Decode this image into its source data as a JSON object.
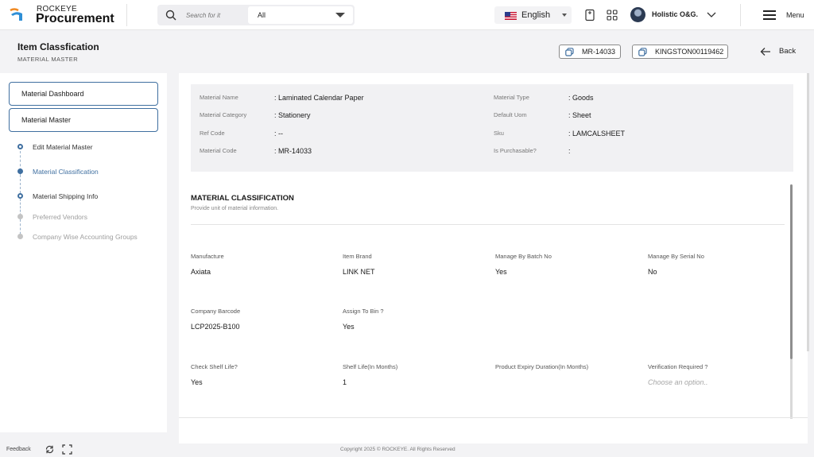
{
  "header": {
    "brand_top": "ROCKEYE",
    "brand_main": "Procurement",
    "search_placeholder": "Search for it",
    "search_scope": "All",
    "language": "English",
    "user_name": "Holistic O&G.",
    "menu_label": "Menu"
  },
  "page": {
    "title": "Item Classfication",
    "subtitle": "MATERIAL MASTER",
    "chips": [
      "MR-14033",
      "KINGSTON00119462"
    ],
    "back_label": "Back"
  },
  "sidebar": {
    "buttons": [
      "Material Dashboard",
      "Material Master"
    ],
    "steps": [
      {
        "label": "Edit Material Master",
        "state": "active"
      },
      {
        "label": "Material Classification",
        "state": "current"
      },
      {
        "label": "Material Shipping Info",
        "state": "active"
      },
      {
        "label": "Preferred Vendors",
        "state": "inactive"
      },
      {
        "label": "Company Wise Accounting Groups",
        "state": "inactive"
      }
    ]
  },
  "info": {
    "left": [
      {
        "label": "Material Name",
        "value": ": Laminated Calendar Paper"
      },
      {
        "label": "Material Category",
        "value": ": Stationery"
      },
      {
        "label": "Ref Code",
        "value": ": --"
      },
      {
        "label": "Material Code",
        "value": ": MR-14033"
      }
    ],
    "right": [
      {
        "label": "Material Type",
        "value": ": Goods"
      },
      {
        "label": "Default Uom",
        "value": ": Sheet"
      },
      {
        "label": "Sku",
        "value": ": LAMCALSHEET"
      },
      {
        "label": "Is Purchasable?",
        "value": ":"
      }
    ]
  },
  "classification": {
    "title": "MATERIAL CLASSIFICATION",
    "subtitle": "Provide unit of material information.",
    "fields": [
      {
        "label": "Manufacture",
        "value": "Axiata"
      },
      {
        "label": "Item Brand",
        "value": "LINK NET"
      },
      {
        "label": "Manage By Batch No",
        "value": "Yes"
      },
      {
        "label": "Manage By Serial No",
        "value": "No"
      },
      {
        "label": "Company Barcode",
        "value": "LCP2025-B100"
      },
      {
        "label": "Assign To Bin ?",
        "value": "Yes"
      },
      {
        "label": "Check Shelf Life?",
        "value": "Yes"
      },
      {
        "label": "Shelf Life(In Months)",
        "value": "1"
      },
      {
        "label": "Product Expiry Duration(In Months)",
        "value": ""
      },
      {
        "label": "Verification Required ?",
        "value": "",
        "placeholder": "Choose an option.."
      }
    ]
  },
  "footer": {
    "feedback": "Feedback",
    "copyright": "Copyright 2025 © ROCKEYE. All Rights Reserved"
  },
  "colors": {
    "accent": "#3f6fa0",
    "logo_blue": "#2f8fd6",
    "logo_orange": "#f08a24"
  }
}
